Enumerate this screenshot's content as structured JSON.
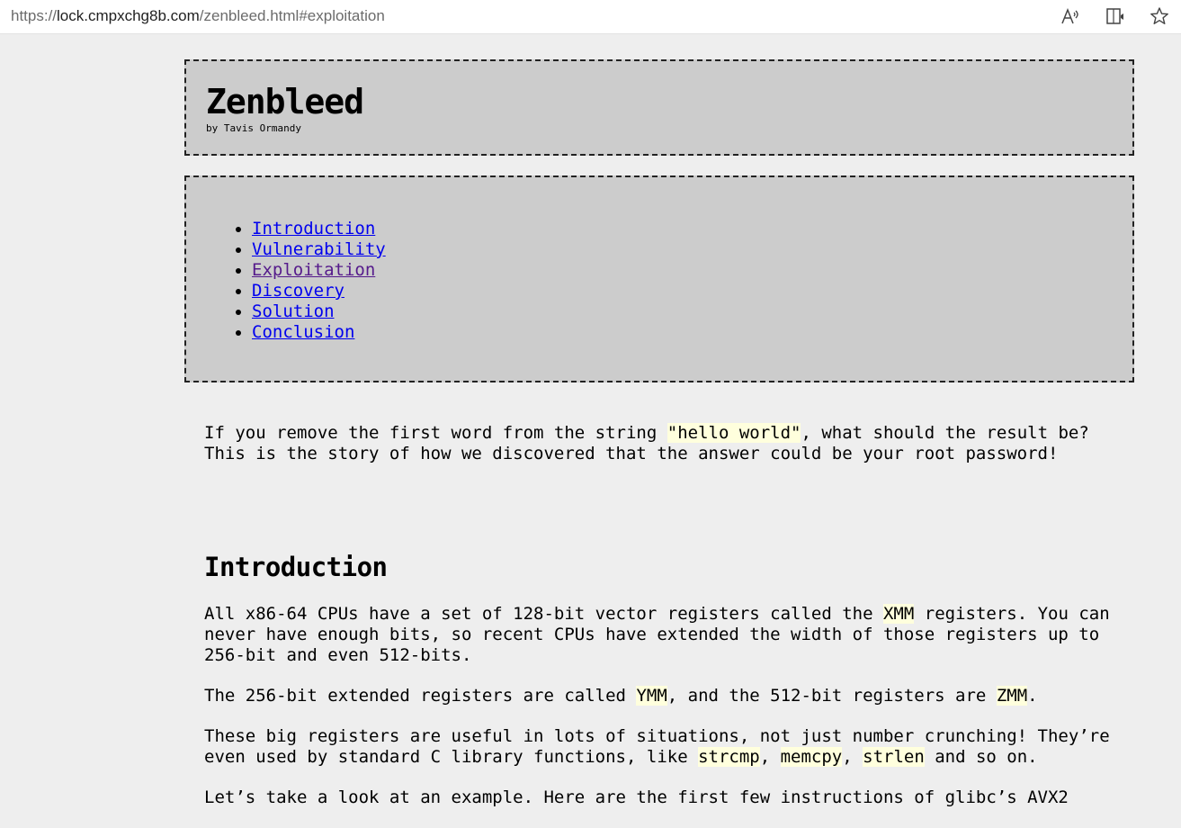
{
  "browser": {
    "url_prefix": "https://",
    "url_host": "lock.cmpxchg8b.com",
    "url_path": "/zenbleed.html#exploitation",
    "icons": [
      "read-aloud-icon",
      "immersive-reader-icon",
      "favorite-star-icon"
    ]
  },
  "header": {
    "title": "Zenbleed",
    "byline": "by Tavis Ormandy"
  },
  "toc": {
    "items": [
      {
        "label": "Introduction"
      },
      {
        "label": "Vulnerability"
      },
      {
        "label": "Exploitation"
      },
      {
        "label": "Discovery"
      },
      {
        "label": "Solution"
      },
      {
        "label": "Conclusion"
      }
    ]
  },
  "content": {
    "intro_before": "If you remove the first word from the string ",
    "intro_code": "\"hello world\"",
    "intro_after": ", what should the result be? This is the story of how we discovered that the answer could be your root password!",
    "section_heading": "Introduction",
    "p1_before": "All x86-64 CPUs have a set of 128-bit vector registers called the ",
    "p1_code": "XMM",
    "p1_after": " registers. You can never have enough bits, so recent CPUs have extended the width of those registers up to 256-bit and even 512-bits.",
    "p2_before": "The 256-bit extended registers are called ",
    "p2_code1": "YMM",
    "p2_mid": ", and the 512-bit registers are ",
    "p2_code2": "ZMM",
    "p2_after": ".",
    "p3_before": "These big registers are useful in lots of situations, not just number crunching! They’re even used by standard C library functions, like ",
    "p3_code1": "strcmp",
    "p3_sep1": ", ",
    "p3_code2": "memcpy",
    "p3_sep2": ", ",
    "p3_code3": "strlen",
    "p3_after": " and so on.",
    "p4": "Let’s take a look at an example. Here are the first few instructions of glibc’s AVX2"
  }
}
